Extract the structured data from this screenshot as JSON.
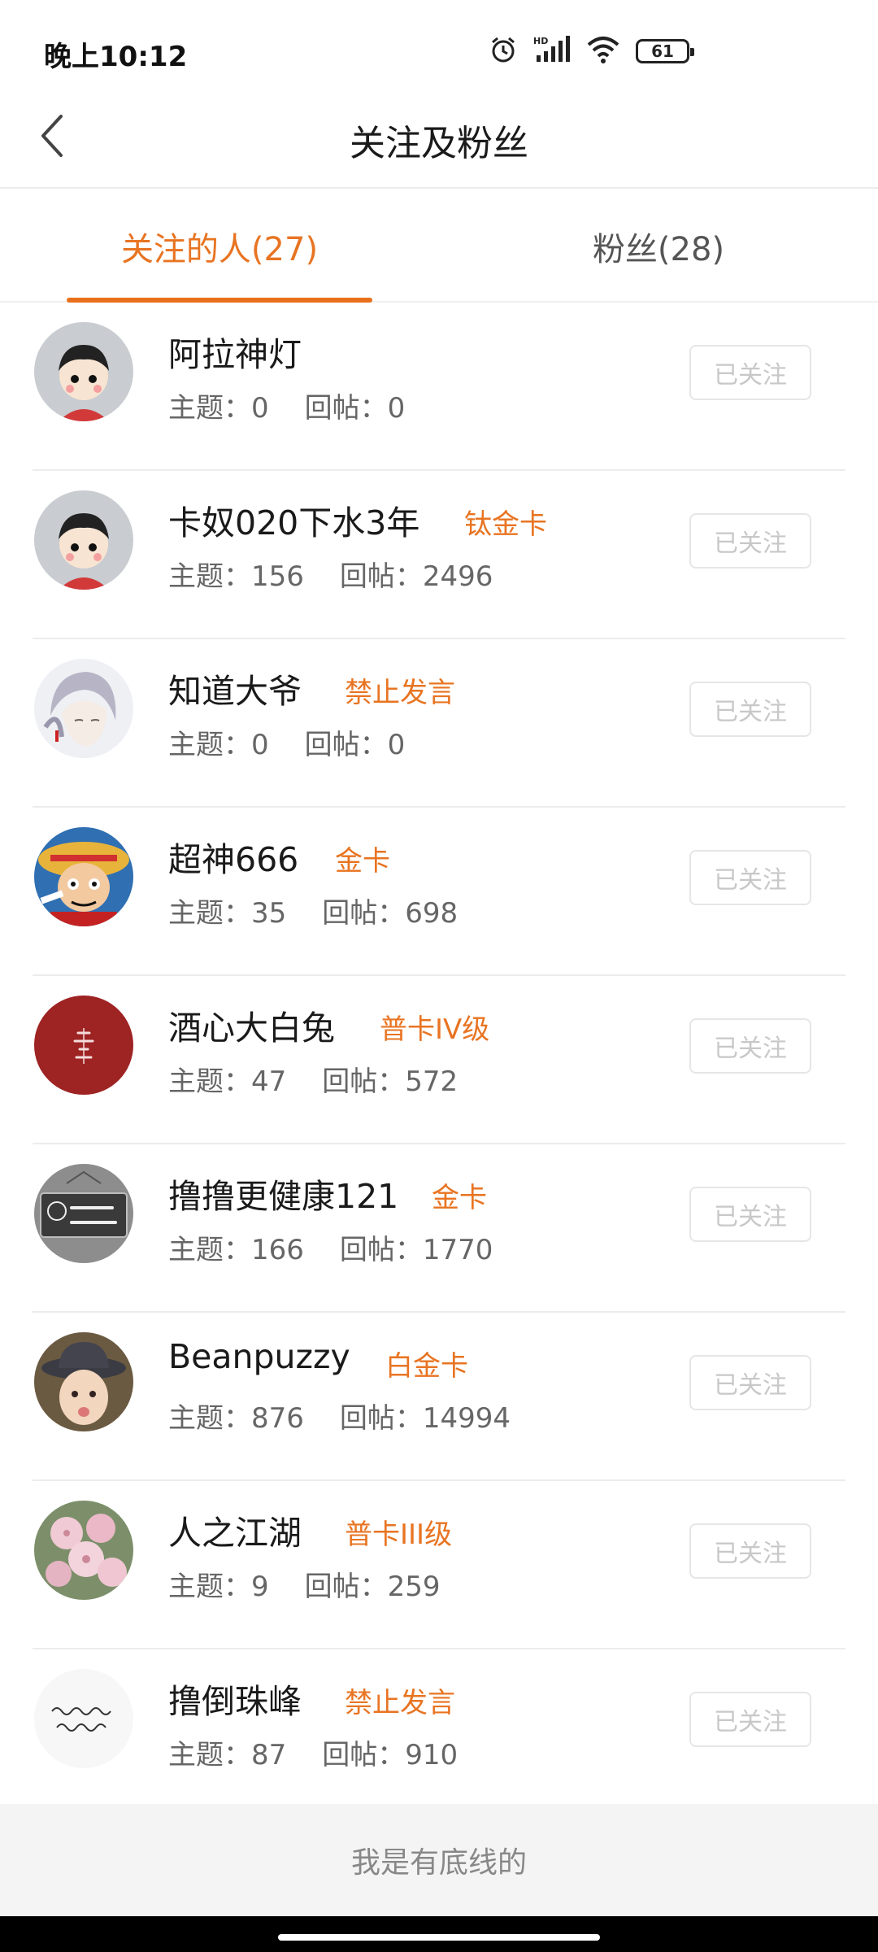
{
  "status_bar": {
    "time": "晚上10:12",
    "battery": "61",
    "icons": [
      "alarm-icon",
      "hd-signal-icon",
      "wifi-icon",
      "battery-icon"
    ]
  },
  "header": {
    "title": "关注及粉丝",
    "back_icon": "chevron-left-icon"
  },
  "tabs": [
    {
      "label": "关注的人(27)",
      "active": true
    },
    {
      "label": "粉丝(28)",
      "active": false
    }
  ],
  "users": [
    {
      "name": "阿拉神灯",
      "badge": "",
      "topics": "主题：0",
      "replies": "回帖：0",
      "button": "已关注",
      "avatar": "cartoon-boy-avatar"
    },
    {
      "name": "卡奴020下水3年",
      "badge": "钛金卡",
      "topics": "主题：156",
      "replies": "回帖：2496",
      "button": "已关注",
      "avatar": "cartoon-boy-avatar"
    },
    {
      "name": "知道大爷",
      "badge": "禁止发言",
      "topics": "主题：0",
      "replies": "回帖：0",
      "button": "已关注",
      "avatar": "anime-boy-avatar"
    },
    {
      "name": "超神666",
      "badge": "金卡",
      "topics": "主题：35",
      "replies": "回帖：698",
      "button": "已关注",
      "avatar": "luffy-avatar"
    },
    {
      "name": "酒心大白兔",
      "badge": "普卡IV级",
      "topics": "主题：47",
      "replies": "回帖：572",
      "button": "已关注",
      "avatar": "red-calligraphy-avatar"
    },
    {
      "name": "撸撸更健康121",
      "badge": "金卡",
      "topics": "主题：166",
      "replies": "回帖：1770",
      "button": "已关注",
      "avatar": "sign-board-avatar"
    },
    {
      "name": "Beanpuzzy",
      "badge": "白金卡",
      "topics": "主题：876",
      "replies": "回帖：14994",
      "button": "已关注",
      "avatar": "child-hat-avatar"
    },
    {
      "name": "人之江湖",
      "badge": "普卡III级",
      "topics": "主题：9",
      "replies": "回帖：259",
      "button": "已关注",
      "avatar": "flowers-avatar"
    },
    {
      "name": "撸倒珠峰",
      "badge": "禁止发言",
      "topics": "主题：87",
      "replies": "回帖：910",
      "button": "已关注",
      "avatar": "handwriting-avatar"
    }
  ],
  "footer": {
    "text": "我是有底线的"
  },
  "colors": {
    "accent": "#e87422",
    "muted": "#666666",
    "button_text": "#c8c8c8"
  }
}
